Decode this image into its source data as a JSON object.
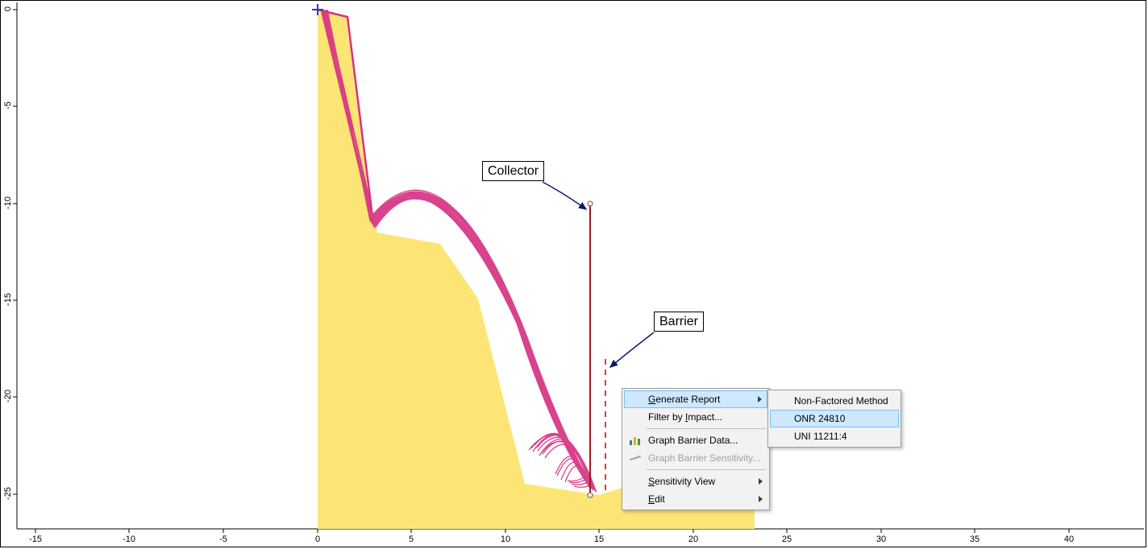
{
  "chart_data": {
    "type": "line",
    "xlabel": "",
    "ylabel": "",
    "xlim": [
      -18,
      42
    ],
    "ylim": [
      -26,
      1
    ],
    "x_ticks": [
      -15,
      -10,
      -5,
      0,
      5,
      10,
      15,
      20,
      25,
      30,
      35,
      40
    ],
    "y_ticks": [
      0,
      -5,
      -10,
      -15,
      -20,
      -25
    ],
    "slope_profile": [
      {
        "x": 0,
        "y": 0
      },
      {
        "x": 3.5,
        "y": -11.5
      },
      {
        "x": 6.5,
        "y": -12.0
      },
      {
        "x": 8.5,
        "y": -15.0
      },
      {
        "x": 11.0,
        "y": -24.5
      },
      {
        "x": 15.0,
        "y": -25.0
      },
      {
        "x": 23.3,
        "y": -22.5
      },
      {
        "x": 23.3,
        "y": -26.0
      },
      {
        "x": 0,
        "y": -26.0
      }
    ],
    "slope_color": "#fde575",
    "seeder": {
      "x": 0,
      "y": 0,
      "marker": "plus",
      "color": "#2a3fbf"
    },
    "collector": {
      "x1": 14.5,
      "y1": -10.0,
      "x2": 14.5,
      "y2": -25.0,
      "color": "#b01a1a"
    },
    "barrier": {
      "x": 15.3,
      "y_top": -18.0,
      "y_bot": -24.8,
      "color": "#e03a3a",
      "dashed": true
    },
    "trajectory_count": 50,
    "trajectory_color": "#d63384"
  },
  "annotations": {
    "collector_label": "Collector",
    "barrier_label": "Barrier"
  },
  "context_menu": {
    "items": [
      {
        "label": "Generate Report",
        "submenu": true,
        "underline_index": 0,
        "highlight": true
      },
      {
        "label": "Filter by Impact...",
        "underline_index": 10
      },
      {
        "sep": true
      },
      {
        "label": "Graph Barrier Data...",
        "icon": "barchart"
      },
      {
        "label": "Graph Barrier Sensitivity...",
        "icon": "lineplot",
        "disabled": true
      },
      {
        "sep": true
      },
      {
        "label": "Sensitivity View",
        "submenu": true,
        "underline_index": 0
      },
      {
        "label": "Edit",
        "submenu": true,
        "underline_index": 0
      }
    ]
  },
  "submenu": {
    "items": [
      {
        "label": "Non-Factored Method"
      },
      {
        "label": "ONR 24810",
        "highlight": true
      },
      {
        "label": "UNI 11211:4"
      }
    ]
  }
}
